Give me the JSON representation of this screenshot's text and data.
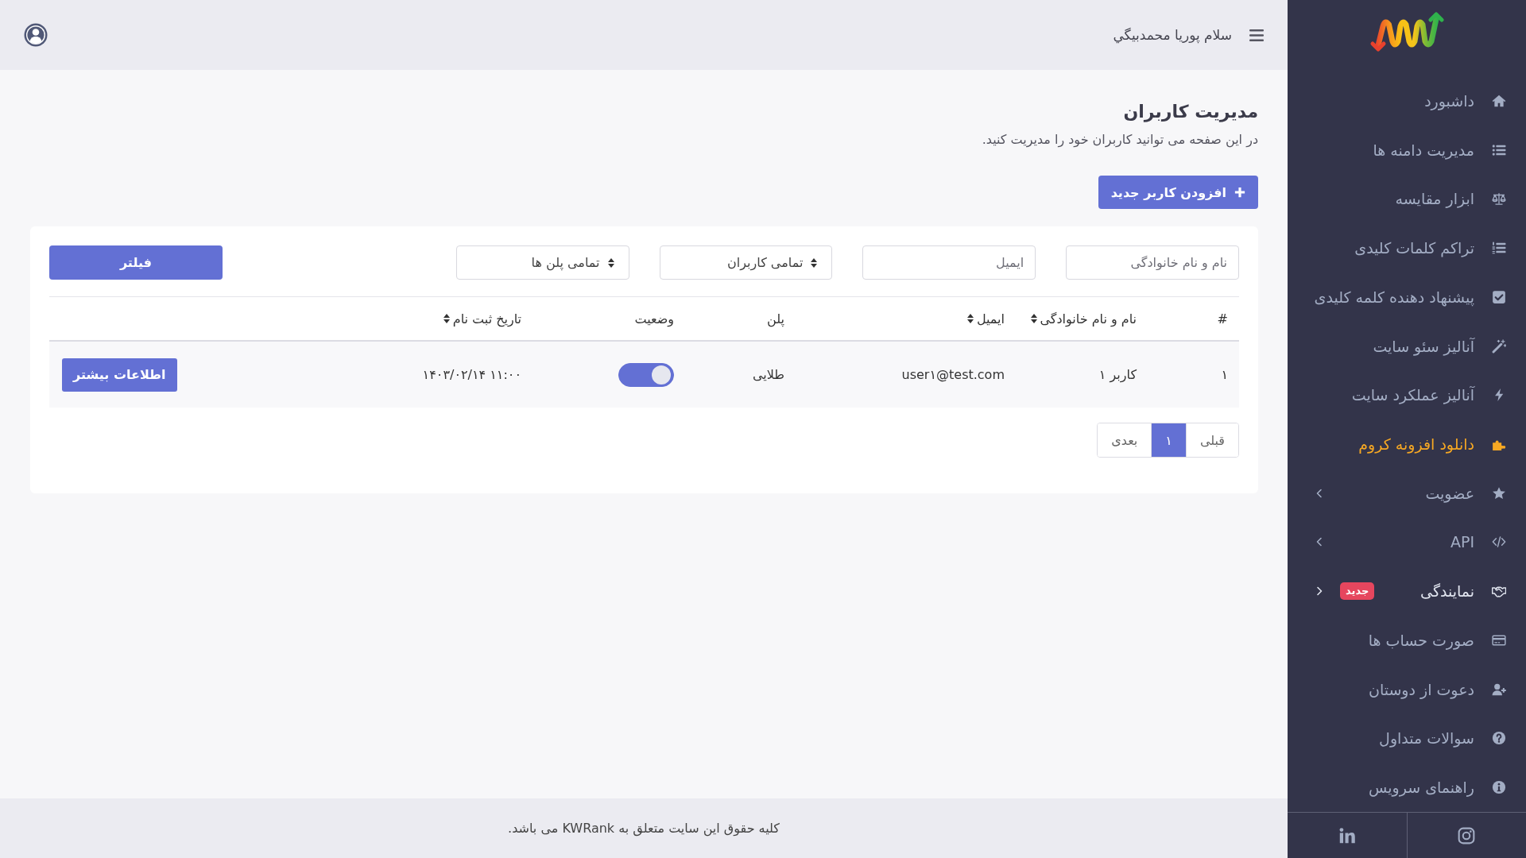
{
  "sidebar": {
    "items": [
      {
        "label": "داشبورد",
        "selected": false,
        "highlighted": false,
        "expandable": false
      },
      {
        "label": "مدیریت دامنه ها",
        "selected": false,
        "highlighted": false,
        "expandable": false
      },
      {
        "label": "ابزار مقایسه",
        "selected": false,
        "highlighted": false,
        "expandable": false
      },
      {
        "label": "تراکم کلمات کلیدی",
        "selected": false,
        "highlighted": false,
        "expandable": false
      },
      {
        "label": "پیشنهاد دهنده کلمه کلیدی",
        "selected": false,
        "highlighted": false,
        "expandable": false
      },
      {
        "label": "آنالیز سئو سایت",
        "selected": false,
        "highlighted": false,
        "expandable": false
      },
      {
        "label": "آنالیز عملکرد سایت",
        "selected": false,
        "highlighted": false,
        "expandable": false
      },
      {
        "label": "دانلود افزونه کروم",
        "selected": false,
        "highlighted": true,
        "expandable": false
      },
      {
        "label": "عضویت",
        "selected": false,
        "highlighted": false,
        "expandable": true,
        "expanded": false
      },
      {
        "label": "API",
        "selected": false,
        "highlighted": false,
        "expandable": true,
        "expanded": false
      },
      {
        "label": "نمایندگی",
        "selected": true,
        "highlighted": false,
        "expandable": true,
        "expanded": true,
        "badge": "جدید"
      },
      {
        "label": "صورت حساب ها",
        "selected": false,
        "highlighted": false,
        "expandable": false
      },
      {
        "label": "دعوت از دوستان",
        "selected": false,
        "highlighted": false,
        "expandable": false
      },
      {
        "label": "سوالات متداول",
        "selected": false,
        "highlighted": false,
        "expandable": false
      },
      {
        "label": "راهنمای سرویس",
        "selected": false,
        "highlighted": false,
        "expandable": false
      }
    ]
  },
  "topbar": {
    "greeting": "سلام پوریا محمدبیگي"
  },
  "page": {
    "title": "مدیریت کاربران",
    "subtitle": "در این صفحه می توانید کاربران خود را مدیریت کنید.",
    "add_button": "افزودن کاربر جدید"
  },
  "filters": {
    "fields": [
      {
        "kind": "text",
        "placeholder": "نام و نام خانوادگی"
      },
      {
        "kind": "text",
        "placeholder": "ایمیل"
      },
      {
        "kind": "select",
        "value": "تمامی کاربران"
      },
      {
        "kind": "select",
        "value": "تمامی پلن ها"
      }
    ],
    "button": "فیلتر"
  },
  "table": {
    "columns": [
      {
        "label": "#",
        "sortable": false
      },
      {
        "label": "نام و نام خانوادگی",
        "sortable": true
      },
      {
        "label": "ایمیل",
        "sortable": true
      },
      {
        "label": "پلن",
        "sortable": false
      },
      {
        "label": "وضعیت",
        "sortable": false
      },
      {
        "label": "تاریخ ثبت نام",
        "sortable": true
      }
    ],
    "rows": [
      {
        "index": "۱",
        "name": "کاربر ۱",
        "email": "user۱@test.com",
        "plan": "طلایی",
        "active": true,
        "registered": "۱۴۰۳/۰۲/۱۴ ۱۱:۰۰",
        "action": "اطلاعات بیشتر"
      }
    ]
  },
  "pagination": [
    {
      "label": "قبلی",
      "selected": false
    },
    {
      "label": "۱",
      "selected": true
    },
    {
      "label": "بعدی",
      "selected": false
    }
  ],
  "footer": {
    "text": "کلیه حقوق این سایت متعلق به KWRank می باشد."
  }
}
